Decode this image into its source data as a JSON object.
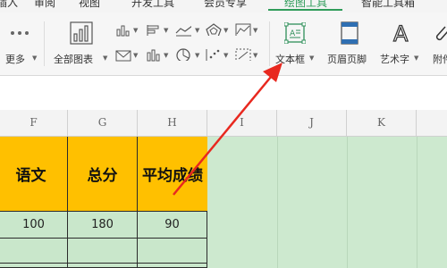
{
  "menu": {
    "tabs": [
      "插入",
      "审阅",
      "视图",
      "开发工具",
      "会员专享",
      "绘图工具",
      "智能工具箱"
    ],
    "active_index": 5
  },
  "ribbon": {
    "more_label": "更多",
    "all_charts_label": "全部图表",
    "textbox_label": "文本框",
    "header_footer_label": "页眉页脚",
    "wordart_label": "艺术字",
    "attachment_label": "附件"
  },
  "sheet": {
    "columns": [
      "F",
      "G",
      "H",
      "I",
      "J",
      "K"
    ],
    "header_row": [
      "语文",
      "总分",
      "平均成绩"
    ],
    "data_rows": [
      [
        "100",
        "180",
        "90"
      ],
      [
        "",
        "",
        ""
      ],
      [
        "",
        "",
        ""
      ]
    ]
  },
  "colors": {
    "header_fill": "#ffc000",
    "data_fill": "#c9e7cb",
    "arrow": "#e8281f",
    "active_tab": "#2f9c5a"
  }
}
